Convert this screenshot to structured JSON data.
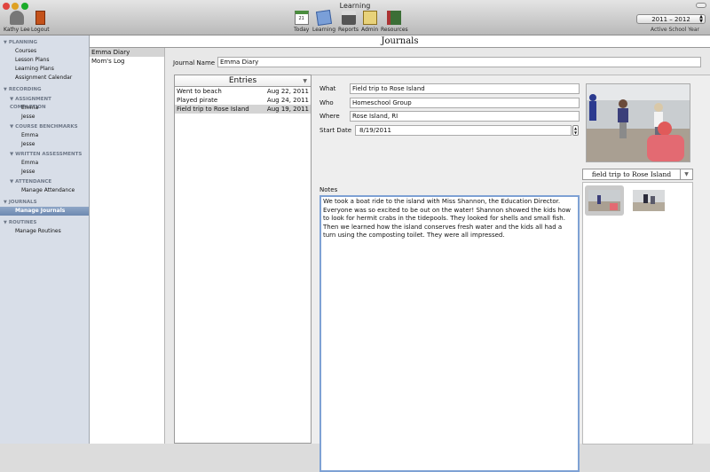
{
  "window": {
    "title": "Learning"
  },
  "toolbar": {
    "user_label": "Kathy Lee",
    "logout_label": "Logout",
    "today_label": "Today",
    "learning_label": "Learning",
    "reports_label": "Reports",
    "admin_label": "Admin",
    "resources_label": "Resources",
    "calendar_day": "21",
    "school_year": "2011 – 2012",
    "school_year_caption": "Active School Year"
  },
  "sidebar": {
    "planning": {
      "header": "PLANNING",
      "items": [
        "Courses",
        "Lesson Plans",
        "Learning Plans",
        "Assignment Calendar"
      ]
    },
    "recording": {
      "header": "RECORDING"
    },
    "assignment_completion": {
      "header": "ASSIGNMENT COMPLETION",
      "items": [
        "Emma",
        "Jesse"
      ]
    },
    "course_benchmarks": {
      "header": "COURSE BENCHMARKS",
      "items": [
        "Emma",
        "Jesse"
      ]
    },
    "written_assessments": {
      "header": "WRITTEN ASSESSMENTS",
      "items": [
        "Emma",
        "Jesse"
      ]
    },
    "attendance": {
      "header": "ATTENDANCE",
      "items": [
        "Manage Attendance"
      ]
    },
    "journals": {
      "header": "JOURNALS",
      "items": [
        "Manage Journals"
      ]
    },
    "routines": {
      "header": "ROUTINES",
      "items": [
        "Manage Routines"
      ]
    }
  },
  "page": {
    "title": "Journals"
  },
  "journals": [
    "Emma Diary",
    "Mom's Log"
  ],
  "journal_name": {
    "label": "Journal Name",
    "value": "Emma Diary"
  },
  "entries": {
    "header": "Entries",
    "rows": [
      {
        "title": "Went to beach",
        "date": "Aug 22, 2011"
      },
      {
        "title": "Played pirate",
        "date": "Aug 24, 2011"
      },
      {
        "title": "Field trip to Rose Island",
        "date": "Aug 19, 2011"
      }
    ]
  },
  "detail": {
    "what_label": "What",
    "what_value": "Field trip to Rose Island",
    "who_label": "Who",
    "who_value": "Homeschool Group",
    "where_label": "Where",
    "where_value": "Rose Island, RI",
    "start_label": "Start Date",
    "start_value": "8/19/2011",
    "notes_label": "Notes",
    "notes_value": "We took a boat ride to the island with Miss Shannon, the Education Director. Everyone was so excited to be out on the water! Shannon showed the kids how to look for hermit crabs in the tidepools. They looked for shells and small fish. Then we learned how the island conserves fresh water and the kids all had a turn using the composting toilet. They were all impressed."
  },
  "photos": {
    "selected_caption": "field trip to Rose Island"
  }
}
